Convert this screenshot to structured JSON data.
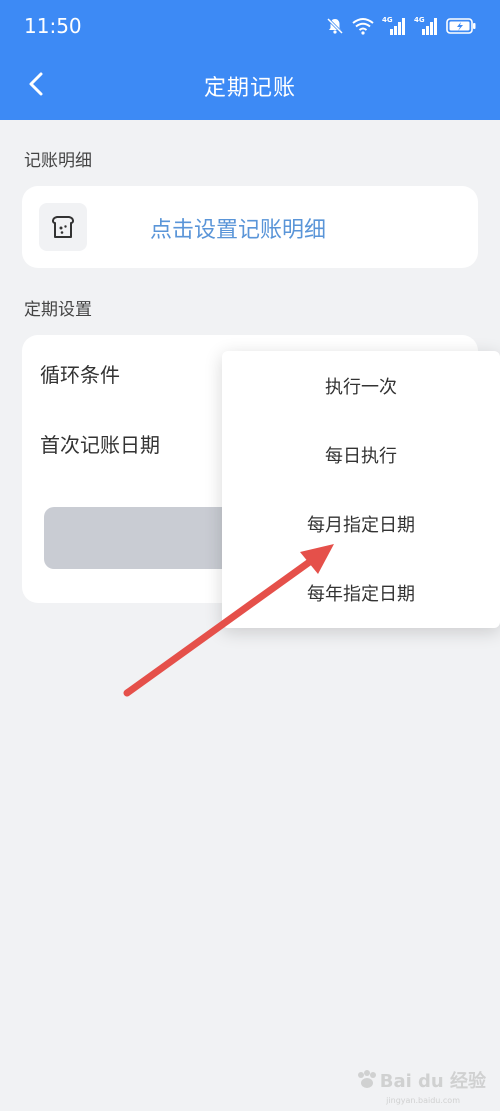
{
  "status_bar": {
    "time": "11:50",
    "icons": [
      "mute-bell-icon",
      "wifi-icon",
      "signal-4g-icon",
      "signal-4g-icon",
      "battery-charging-icon"
    ],
    "signal_label": "4G"
  },
  "header": {
    "title": "定期记账",
    "back_icon": "chevron-left-icon",
    "bg_color": "#3d8af5"
  },
  "detail_section": {
    "label": "记账明细",
    "icon": "bread-icon",
    "link_text": "点击设置记账明细",
    "link_color": "#5a95d8"
  },
  "settings_section": {
    "label": "定期设置",
    "rows": [
      {
        "label": "循环条件"
      },
      {
        "label": "首次记账日期"
      }
    ]
  },
  "dropdown": {
    "options": [
      "执行一次",
      "每日执行",
      "每月指定日期",
      "每年指定日期"
    ]
  },
  "annotation": {
    "arrow_color": "#e5504a"
  },
  "watermark": {
    "text": "Bai du 经验",
    "sub": "jingyan.baidu.com"
  }
}
